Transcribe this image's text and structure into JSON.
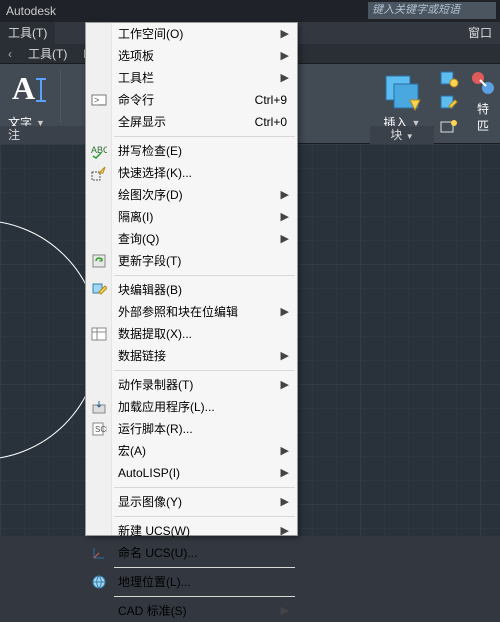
{
  "title": "Autodesk",
  "searchPlaceholder": "键入关键字或短语",
  "menubar": {
    "tools": "工具(T)",
    "window": "窗口"
  },
  "tabrow": {
    "tools": "工具(T)",
    "exp": "Exp"
  },
  "ribbon": {
    "leftBig": "文字",
    "insert": "插入",
    "groupAnno": "注",
    "groupBlock": "块",
    "special": "特",
    "spec2": "匹"
  },
  "menu": {
    "workspace": "工作空间(O)",
    "palettes": "选项板",
    "toolbars": "工具栏",
    "commandline": "命令行",
    "commandlineKey": "Ctrl+9",
    "cleanscreen": "全屏显示",
    "cleanscreenKey": "Ctrl+0",
    "spell": "拼写检查(E)",
    "qselect": "快速选择(K)...",
    "draworder": "绘图次序(D)",
    "isolate": "隔离(I)",
    "inquiry": "查询(Q)",
    "updatefields": "更新字段(T)",
    "blockeditor": "块编辑器(B)",
    "xrefedit": "外部参照和块在位编辑",
    "dataextract": "数据提取(X)...",
    "datalinks": "数据链接",
    "actionrec": "动作录制器(T)",
    "loadapp": "加载应用程序(L)...",
    "runscript": "运行脚本(R)...",
    "macro": "宏(A)",
    "autolisp": "AutoLISP(I)",
    "dispimage": "显示图像(Y)",
    "newucs": "新建 UCS(W)",
    "namedUcs": "命名 UCS(U)...",
    "geoloc": "地理位置(L)...",
    "cadstd": "CAD 标准(S)"
  }
}
